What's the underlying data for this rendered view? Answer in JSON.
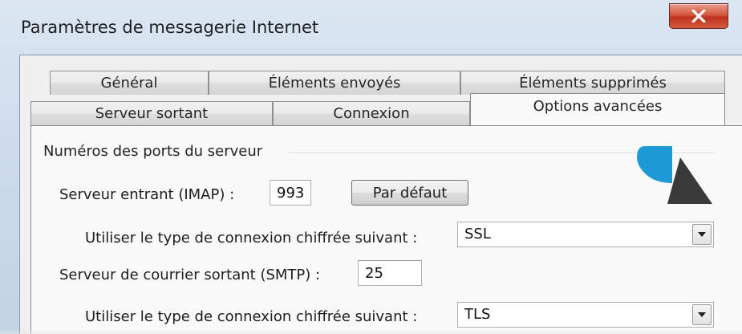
{
  "window": {
    "title": "Paramètres de messagerie Internet",
    "close_glyph": "X"
  },
  "tabs": {
    "row1": [
      {
        "label": "Général"
      },
      {
        "label": "Éléments envoyés"
      },
      {
        "label": "Éléments supprimés"
      }
    ],
    "row2": [
      {
        "label": "Serveur sortant"
      },
      {
        "label": "Connexion"
      },
      {
        "label": "Options avancées",
        "active": true
      }
    ]
  },
  "ports_group": {
    "title": "Numéros des ports du serveur",
    "incoming_label": "Serveur entrant (IMAP) :",
    "incoming_value": "993",
    "default_button": "Par défaut",
    "incoming_encryption_label": "Utiliser le type de connexion chiffrée suivant :",
    "incoming_encryption_value": "SSL",
    "outgoing_label": "Serveur de courrier sortant (SMTP) :",
    "outgoing_value": "25",
    "outgoing_encryption_label": "Utiliser le type de connexion chiffrée suivant :",
    "outgoing_encryption_value": "TLS"
  },
  "icons": {
    "close": "close-icon",
    "dropdown": "chevron-down-icon",
    "watermark": "logo-mark"
  },
  "colors": {
    "close_button": "#c9432c",
    "logo_blue": "#1d9ad6",
    "logo_dark": "#3a3a3a"
  }
}
